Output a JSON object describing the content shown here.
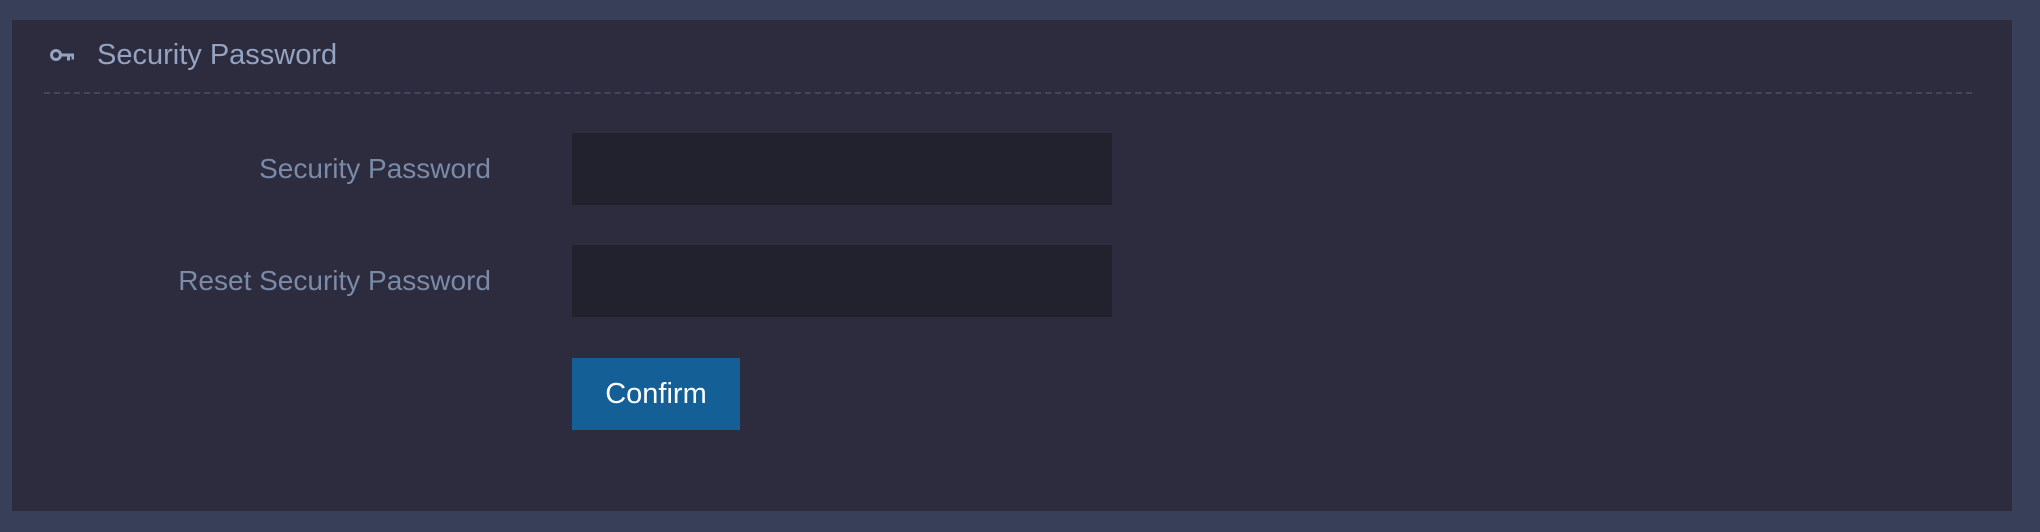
{
  "panel": {
    "title": "Security Password",
    "icon": "key-icon"
  },
  "form": {
    "fields": [
      {
        "label": "Security Password",
        "value": "",
        "placeholder": ""
      },
      {
        "label": "Reset Security Password",
        "value": "",
        "placeholder": ""
      }
    ],
    "confirm_label": "Confirm"
  },
  "colors": {
    "page_background": "#383f58",
    "panel_background": "#2c2c3e",
    "input_background": "#22222f",
    "title_text": "#93a3c1",
    "label_text": "#7b8aa6",
    "button_background": "#145f96",
    "button_text": "#ffffff"
  }
}
